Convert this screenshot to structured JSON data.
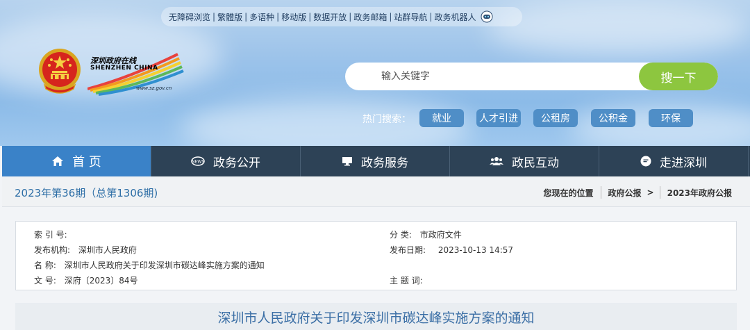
{
  "toplinks": [
    "无障碍浏览",
    "繁體版",
    "多语种",
    "移动版",
    "数据开放",
    "政务邮箱",
    "站群导航",
    "政务机器人"
  ],
  "logo": {
    "cn": "深圳政府在线",
    "en": "SHENZHEN CHINA",
    "url": "www.sz.gov.cn"
  },
  "search": {
    "placeholder": "输入关键字",
    "button": "搜一下"
  },
  "hot": {
    "label": "热门搜索：",
    "tags": [
      "就业",
      "人才引进",
      "公租房",
      "公积金",
      "环保"
    ]
  },
  "nav": [
    {
      "label": "首 页",
      "icon": "home-icon"
    },
    {
      "label": "政务公开",
      "icon": "news-icon"
    },
    {
      "label": "政务服务",
      "icon": "monitor-icon"
    },
    {
      "label": "政民互动",
      "icon": "people-icon"
    },
    {
      "label": "走进深圳",
      "icon": "chat-icon"
    }
  ],
  "issue": "2023年第36期（总第1306期)",
  "breadcrumb": {
    "here": "您现在的位置",
    "level1": "政府公报",
    "level2": "2023年政府公报"
  },
  "info": {
    "index_k": "索 引 号:",
    "index_v": "",
    "cat_k": "分 类:",
    "cat_v": "市政府文件",
    "org_k": "发布机构:",
    "org_v": "深圳市人民政府",
    "date_k": "发布日期:",
    "date_v": "2023-10-13 14:57",
    "name_k": "名 称:",
    "name_v": "深圳市人民政府关于印发深圳市碳达峰实施方案的通知",
    "num_k": "文 号:",
    "num_v": "深府〔2023〕84号",
    "topic_k": "主 题 词:",
    "topic_v": ""
  },
  "title": "深圳市人民政府关于印发深圳市碳达峰实施方案的通知",
  "colors": {
    "nav_bg": "#2d4256",
    "nav_active": "#3a82c8",
    "search_btn": "#8dc63f",
    "tag_bg": "#4f8ec7",
    "title": "#3a6ea5"
  }
}
